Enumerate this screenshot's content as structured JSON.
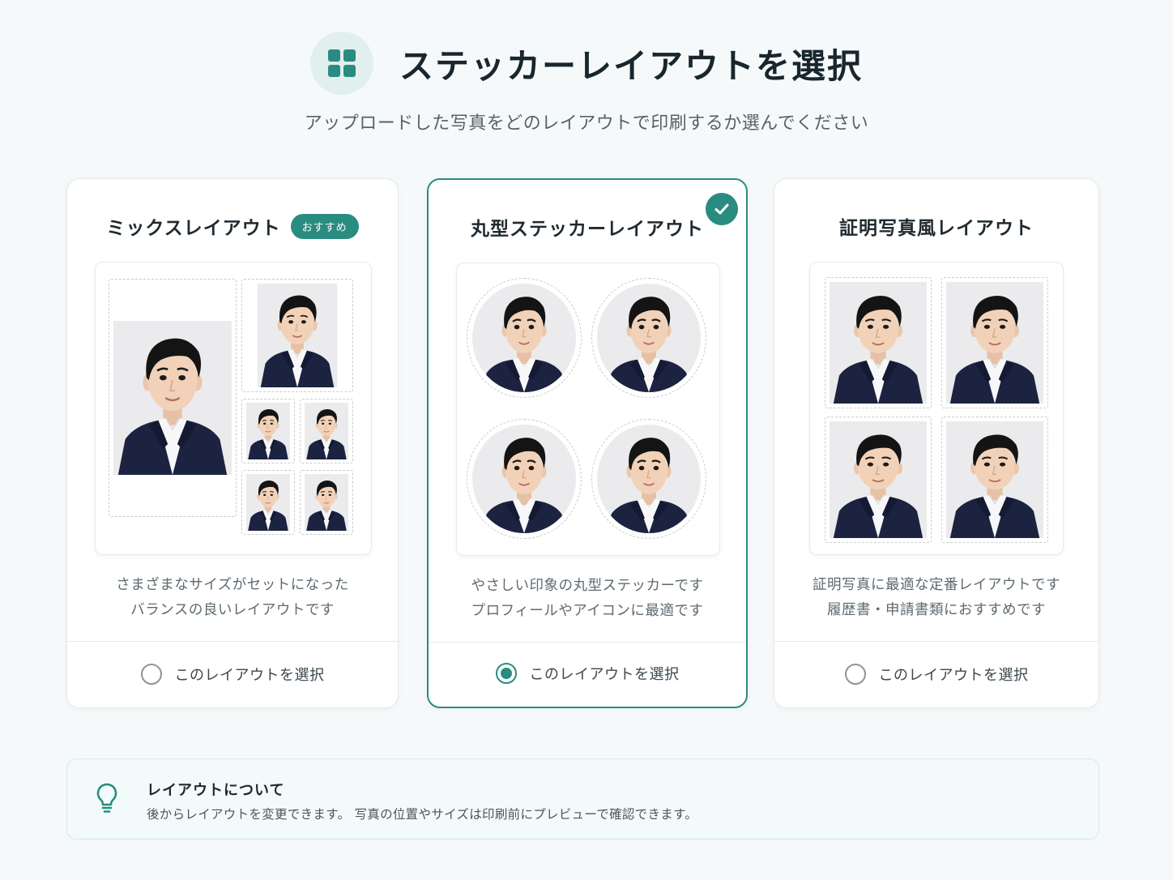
{
  "header": {
    "title": "ステッカーレイアウトを選択",
    "subtitle": "アップロードした写真をどのレイアウトで印刷するか選んでください",
    "icon": "grid-icon"
  },
  "layouts": [
    {
      "title": "ミックスレイアウト",
      "badge": "おすすめ",
      "description_line1": "さまざまなサイズがセットになった",
      "description_line2": "バランスの良いレイアウトです",
      "select_label": "このレイアウトを選択",
      "selected": false
    },
    {
      "title": "丸型ステッカーレイアウト",
      "description_line1": "やさしい印象の丸型ステッカーです",
      "description_line2": "プロフィールやアイコンに最適です",
      "select_label": "このレイアウトを選択",
      "selected": true
    },
    {
      "title": "証明写真風レイアウト",
      "description_line1": "証明写真に最適な定番レイアウトです",
      "description_line2": "履歴書・申請書類におすすめです",
      "select_label": "このレイアウトを選択",
      "selected": false
    }
  ],
  "info": {
    "icon": "lightbulb-icon",
    "title": "レイアウトについて",
    "text": "後からレイアウトを変更できます。 写真の位置やサイズは印刷前にプレビューで確認できます。"
  },
  "colors": {
    "accent": "#2a8c80",
    "background": "#f6f9fa",
    "photo_background": "#e9eaec",
    "suit": "#1c2340",
    "hair": "#141414",
    "skin": "#f1d2b8"
  }
}
